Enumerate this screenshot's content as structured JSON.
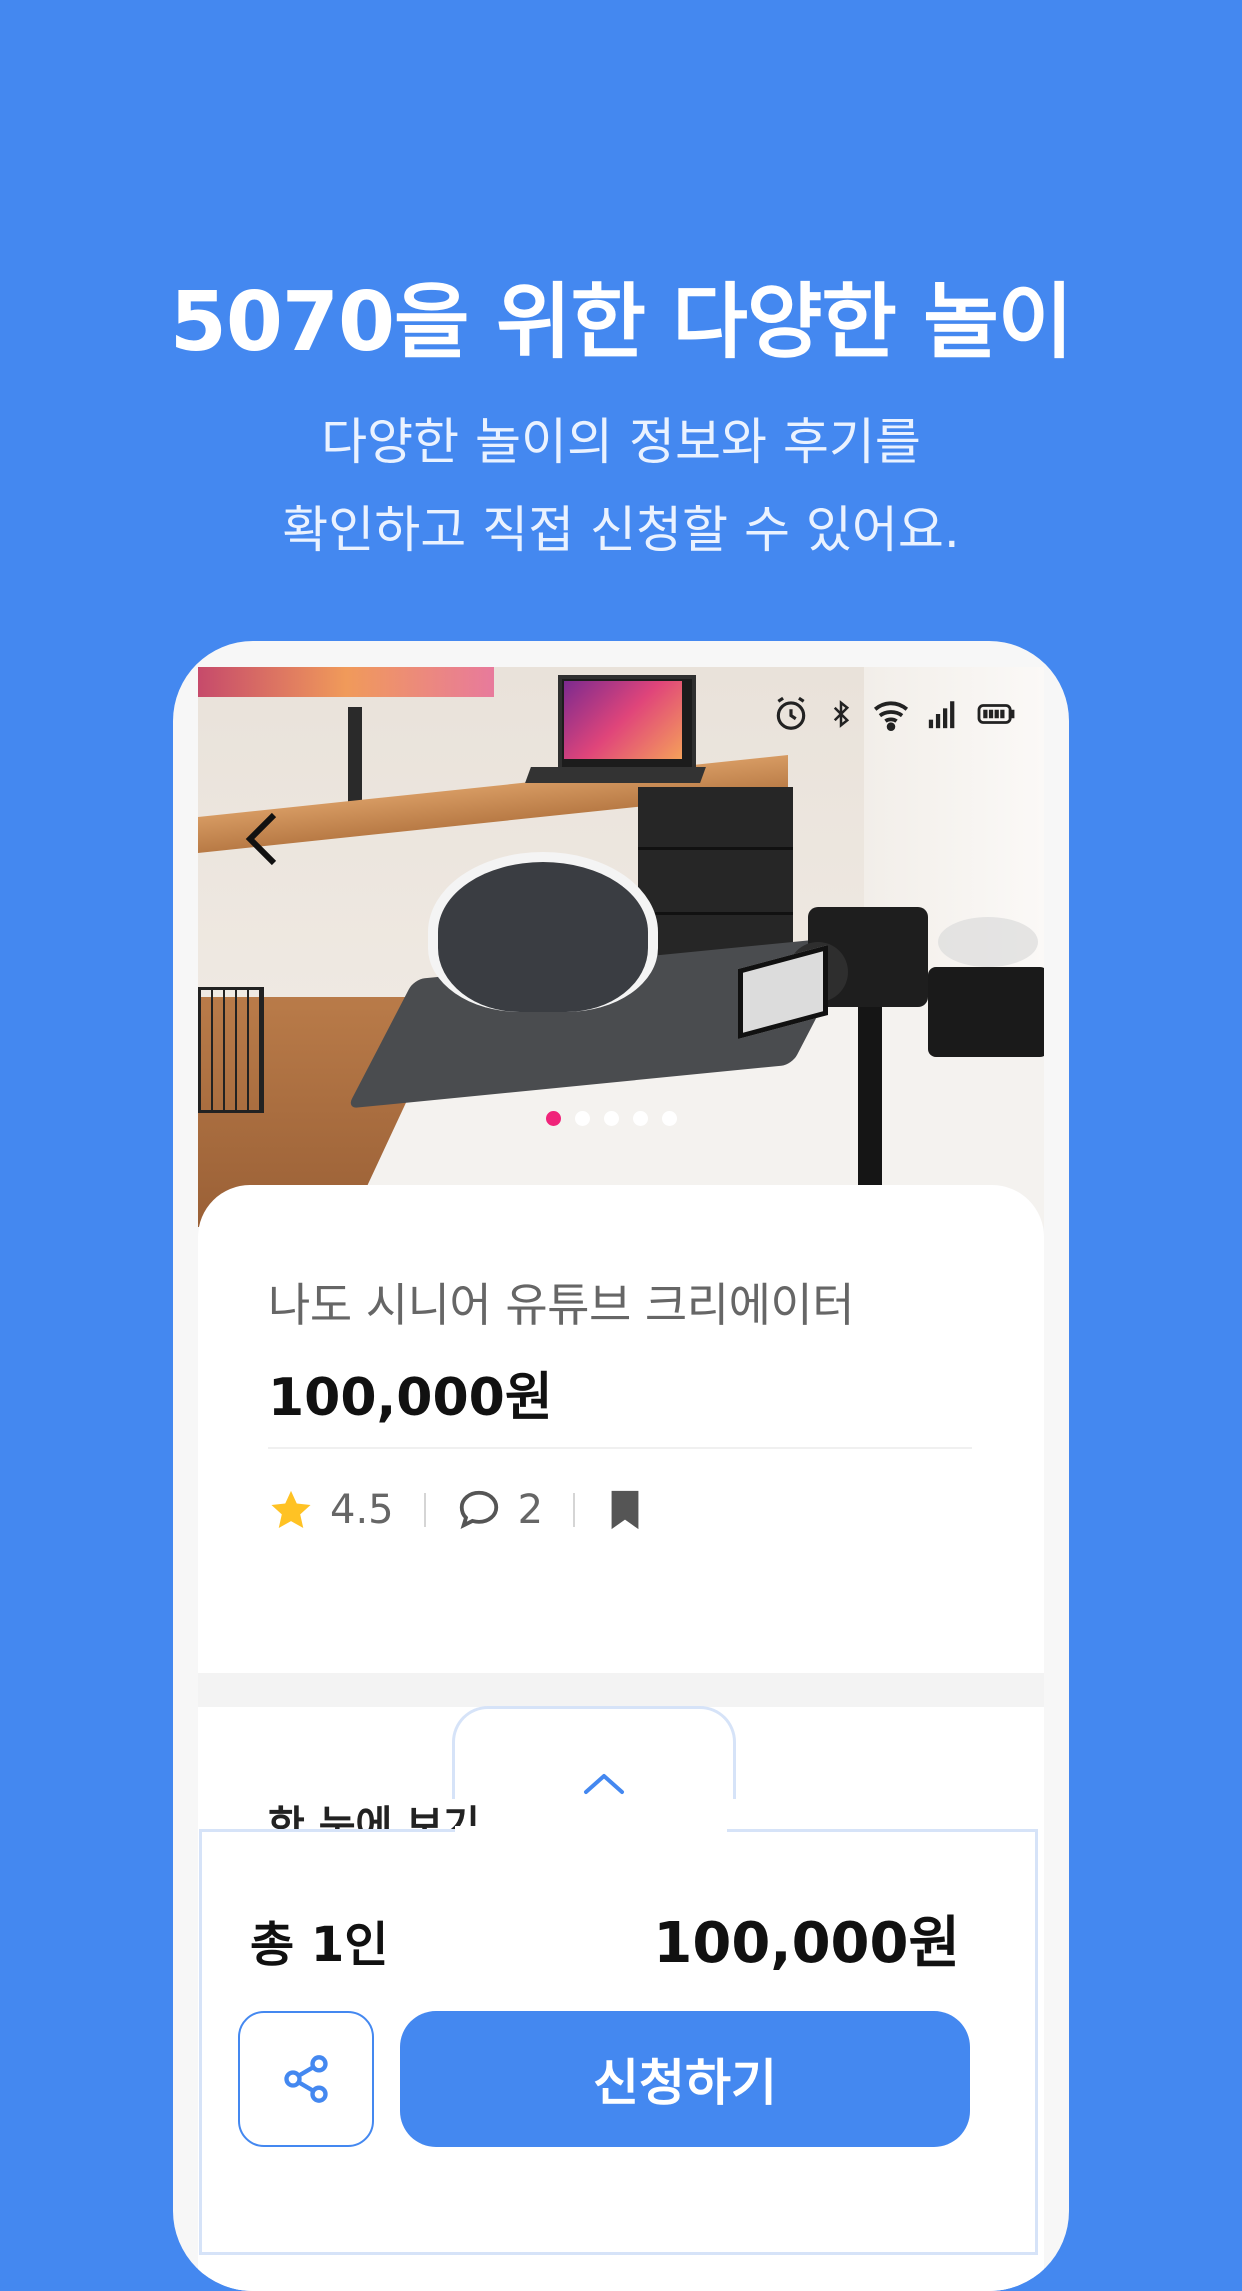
{
  "headline": "5070을 위한 다양한 놀이",
  "subline": [
    "다양한 놀이의 정보와 후기를",
    "확인하고 직접 신청할 수 있어요."
  ],
  "status_bar": {
    "icons": [
      "alarm-icon",
      "bluetooth-icon",
      "wifi-icon",
      "signal-icon",
      "battery-icon"
    ]
  },
  "carousel": {
    "total": 5,
    "active_index": 0,
    "active_color": "#F0247A"
  },
  "product": {
    "title": "나도 시니어  유튜브 크리에이터",
    "price": "100,000원",
    "rating": "4.5",
    "comments": "2"
  },
  "glance": {
    "title": "한 눈에 보기"
  },
  "sheet": {
    "total_label": "총 1인",
    "total_price": "100,000원",
    "apply_label": "신청하기"
  },
  "colors": {
    "brand": "#4488F0",
    "star": "#FFC224"
  }
}
